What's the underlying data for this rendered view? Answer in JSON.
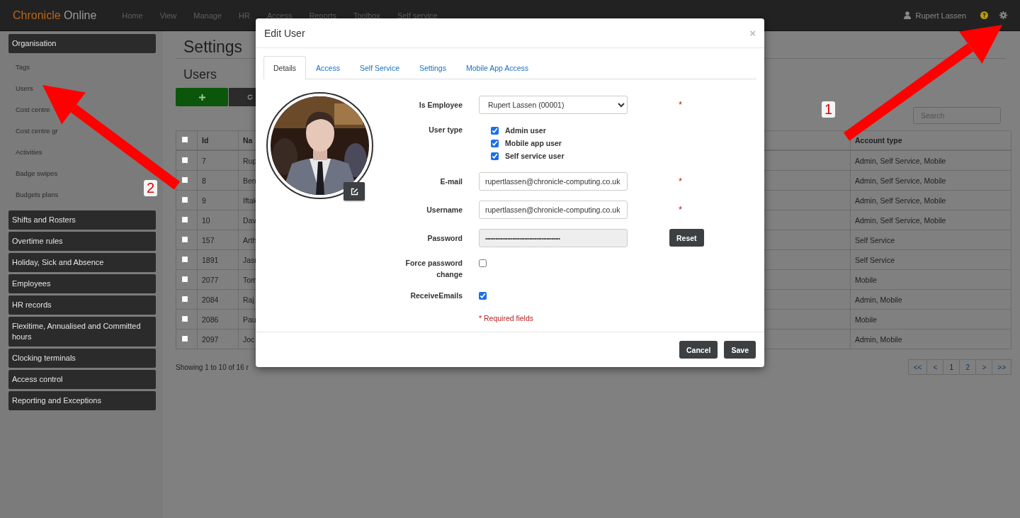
{
  "navbar": {
    "brand": {
      "first": "Chronicle",
      "second": "Online"
    },
    "links": [
      "Home",
      "View",
      "Manage",
      "HR",
      "Access",
      "Reports",
      "Toolbox",
      "Self service"
    ],
    "user": "Rupert Lassen"
  },
  "sidebar": {
    "groups": [
      {
        "label": "Organisation",
        "children": [
          {
            "label": "Tags"
          },
          {
            "label": "Users"
          },
          {
            "label": "Cost centre"
          },
          {
            "label": "Cost centre gr"
          },
          {
            "label": "Activities"
          },
          {
            "label": "Badge swipes"
          },
          {
            "label": "Budgets plans"
          }
        ]
      },
      {
        "label": "Shifts and Rosters"
      },
      {
        "label": "Overtime rules"
      },
      {
        "label": "Holiday, Sick and Absence"
      },
      {
        "label": "Employees"
      },
      {
        "label": "HR records"
      },
      {
        "label": "Flexitime, Annualised and Committed hours"
      },
      {
        "label": "Clocking terminals"
      },
      {
        "label": "Access control"
      },
      {
        "label": "Reporting and Exceptions"
      }
    ]
  },
  "page": {
    "title": "Settings",
    "subtitle": "Users",
    "search": {
      "placeholder": "Search"
    }
  },
  "table": {
    "columns": [
      "Id",
      "Na",
      "Account type"
    ],
    "header_checked": false,
    "rows": [
      {
        "id": "7",
        "name": "Rup",
        "account_type": "Admin, Self Service, Mobile",
        "checked": false
      },
      {
        "id": "8",
        "name": "Ben",
        "account_type": "Admin, Self Service, Mobile",
        "checked": false
      },
      {
        "id": "9",
        "name": "Iftak",
        "account_type": "Admin, Self Service, Mobile",
        "checked": false
      },
      {
        "id": "10",
        "name": "Dav",
        "account_type": "Admin, Self Service, Mobile",
        "checked": false
      },
      {
        "id": "157",
        "name": "Arth",
        "account_type": "Self Service",
        "checked": false
      },
      {
        "id": "1891",
        "name": "Jasr",
        "account_type": "Self Service",
        "checked": false
      },
      {
        "id": "2077",
        "name": "Tom",
        "account_type": "Mobile",
        "checked": false
      },
      {
        "id": "2084",
        "name": "Raj",
        "account_type": "Admin, Mobile",
        "checked": false
      },
      {
        "id": "2086",
        "name": "Pau",
        "account_type": "Mobile",
        "checked": false
      },
      {
        "id": "2097",
        "name": "Joc",
        "account_type": "Admin, Mobile",
        "checked": false
      }
    ],
    "summary": "Showing 1 to 10 of 16 r"
  },
  "pagination": [
    {
      "label": "<<",
      "selected": false
    },
    {
      "label": "<",
      "selected": false
    },
    {
      "label": "1",
      "selected": true
    },
    {
      "label": "2",
      "selected": false
    },
    {
      "label": ">",
      "selected": false
    },
    {
      "label": ">>",
      "selected": false
    }
  ],
  "modal": {
    "title": "Edit User",
    "close": "×",
    "tabs": [
      {
        "label": "Details",
        "selected": true
      },
      {
        "label": "Access",
        "selected": false
      },
      {
        "label": "Self Service",
        "selected": false
      },
      {
        "label": "Settings",
        "selected": false
      },
      {
        "label": "Mobile App Access",
        "selected": false
      }
    ],
    "photo": {
      "kind": "picture"
    },
    "form": {
      "rows": [
        {
          "kind": "select",
          "label": "Is Employee",
          "value": "Rupert Lassen (00001)",
          "required_mark": "*"
        },
        {
          "kind": "checkboxes",
          "label": "User type",
          "options": [
            {
              "label": "Admin user",
              "checked": true
            },
            {
              "label": "Mobile app user",
              "checked": true
            },
            {
              "label": "Self service user",
              "checked": true
            }
          ]
        },
        {
          "kind": "text",
          "label": "E-mail",
          "value": "rupertlassen@chronicle-computing.co.uk",
          "required_mark": "*"
        },
        {
          "kind": "text",
          "label": "Username",
          "value": "rupertlassen@chronicle-computing.co.uk",
          "required_mark": "*"
        },
        {
          "kind": "password",
          "label": "Password",
          "value": "••••••••••••••••••••••••••••••••••••••••••••",
          "button": "Reset"
        },
        {
          "kind": "checkbox",
          "label": "Force password change",
          "checked": false
        },
        {
          "kind": "checkbox",
          "label": "ReceiveEmails",
          "checked": true
        }
      ],
      "note": "* Required fields"
    },
    "buttons": [
      "Cancel",
      "Save"
    ]
  },
  "annotations": [
    {
      "label": "1"
    },
    {
      "label": "2"
    }
  ]
}
